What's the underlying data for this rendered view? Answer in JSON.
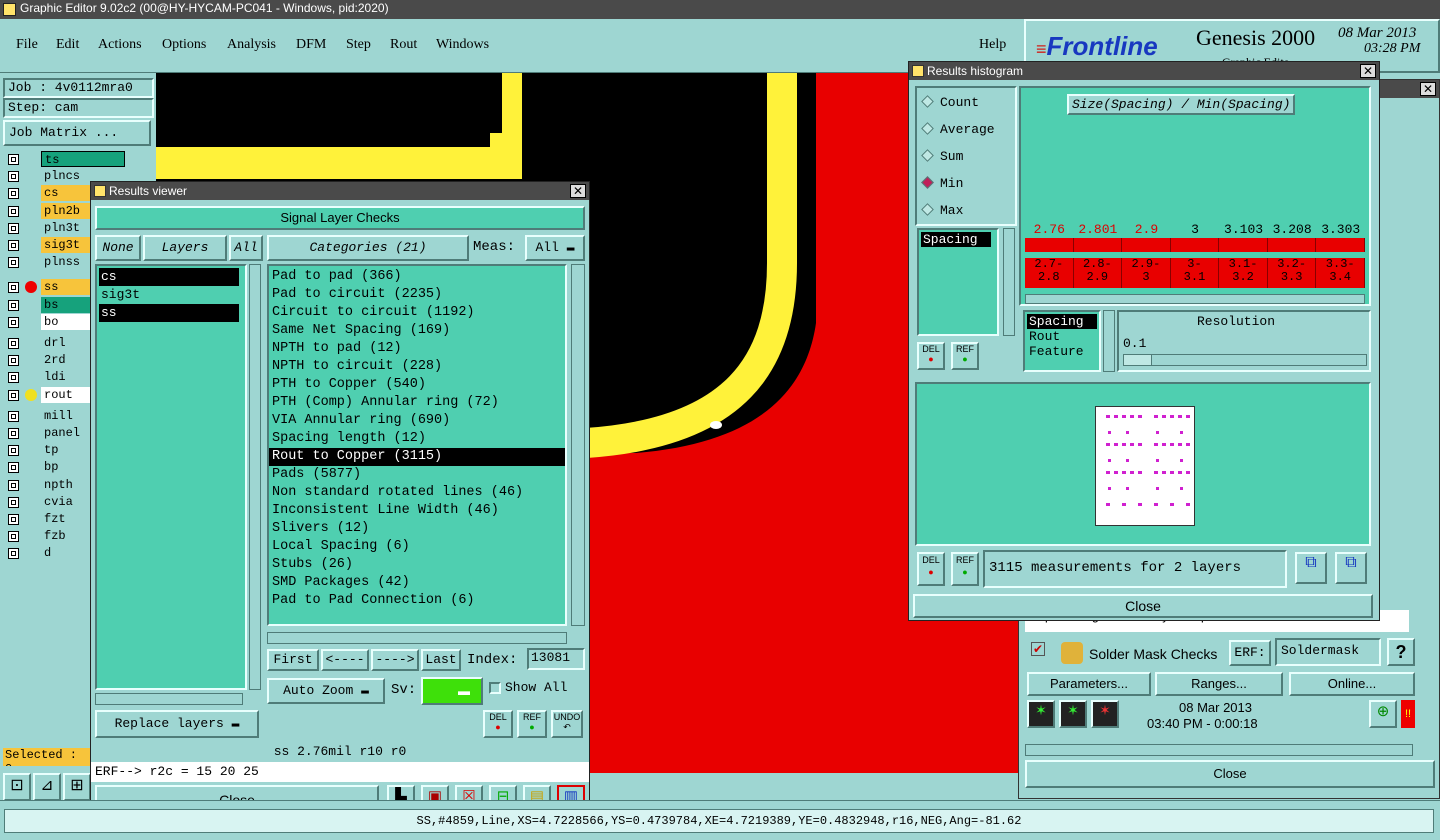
{
  "app": {
    "title": "Graphic Editor 9.02c2 (00@HY-HYCAM-PC041 - Windows, pid:2020)",
    "menu": [
      "File",
      "Edit",
      "Actions",
      "Options",
      "Analysis",
      "DFM",
      "Step",
      "Rout",
      "Windows"
    ],
    "help": "Help",
    "brand": "Frontline",
    "product": "Genesis 2000",
    "date": "08 Mar 2013",
    "time": "03:28 PM",
    "subtitle_partial": "Graphic Edito"
  },
  "left_panel": {
    "job": "Job : 4v0112mra0",
    "step": "Step: cam",
    "job_matrix": "Job Matrix ...",
    "layers": [
      {
        "name": "ts",
        "color": "#16a27c"
      },
      {
        "name": "plncs",
        "color": "#9ed6d2"
      },
      {
        "name": "cs",
        "color": "#f7c43b"
      },
      {
        "name": "pln2b",
        "color": "#f7c43b"
      },
      {
        "name": "pln3t",
        "color": "#9ed6d2"
      },
      {
        "name": "sig3t",
        "color": "#f7c43b"
      },
      {
        "name": "plnss",
        "color": "#9ed6d2"
      },
      {
        "name": "ss",
        "color": "#f7c43b"
      },
      {
        "name": "bs",
        "color": "#16a27c"
      },
      {
        "name": "bo",
        "color": "#ffffff"
      },
      {
        "name": "drl",
        "color": "#9ed6d2"
      },
      {
        "name": "2rd",
        "color": "#9ed6d2"
      },
      {
        "name": "ldi",
        "color": "#9ed6d2"
      },
      {
        "name": "rout",
        "color": "#ffffff"
      },
      {
        "name": "mill",
        "color": "#9ed6d2"
      },
      {
        "name": "panel",
        "color": "#9ed6d2"
      },
      {
        "name": "tp",
        "color": "#9ed6d2"
      },
      {
        "name": "bp",
        "color": "#9ed6d2"
      },
      {
        "name": "npth",
        "color": "#9ed6d2"
      },
      {
        "name": "cvia",
        "color": "#9ed6d2"
      },
      {
        "name": "fzt",
        "color": "#9ed6d2"
      },
      {
        "name": "fzb",
        "color": "#9ed6d2"
      },
      {
        "name": "d",
        "color": "#9ed6d2"
      }
    ],
    "selected": "Selected : 0"
  },
  "results_viewer": {
    "title": "Results viewer",
    "header": "Signal Layer Checks",
    "none_btn": "None",
    "layers_btn": "Layers",
    "all_btn": "All",
    "categories_btn": "Categories (21)",
    "meas_label": "Meas:",
    "meas_value": "All",
    "layer_list": [
      "cs",
      "sig3t",
      "ss"
    ],
    "categories": [
      "Pad to pad (366)",
      "Pad to circuit (2235)",
      "Circuit to circuit (1192)",
      "Same Net Spacing (169)",
      "NPTH to pad (12)",
      "NPTH to circuit (228)",
      "PTH to Copper (540)",
      "PTH (Comp) Annular ring (72)",
      "VIA Annular ring (690)",
      "Spacing length (12)",
      "Rout to Copper (3115)",
      "Pads (5877)",
      "Non standard rotated lines (46)",
      "Inconsistent Line Width (46)",
      "Slivers (12)",
      "Local Spacing (6)",
      "Stubs (26)",
      "SMD Packages (42)",
      "Pad to Pad Connection (6)"
    ],
    "selected_category": "Rout to Copper (3115)",
    "first": "First",
    "prev": "<----",
    "next": "---->",
    "last": "Last",
    "index_label": "Index:",
    "index_value": "13081",
    "auto_zoom": "Auto Zoom",
    "sv_label": "Sv:",
    "show_all": "Show All",
    "replace_layers": "Replace layers",
    "del": "DEL",
    "ref": "REF",
    "undo": "UNDO",
    "status": "ss 2.76mil  r10  r0",
    "erf": "ERF--> r2c = 15 20 25",
    "close": "Close"
  },
  "histogram": {
    "title": "Results histogram",
    "modes": [
      "Count",
      "Average",
      "Sum",
      "Min",
      "Max"
    ],
    "selected_mode": "Min",
    "chart_title": "Size(Spacing) / Min(Spacing)",
    "bars": [
      {
        "value": "2.76",
        "range": "2.7-\n2.8",
        "red": true
      },
      {
        "value": "2.801",
        "range": "2.8-\n2.9",
        "red": true
      },
      {
        "value": "2.9",
        "range": "2.9-\n3",
        "red": true
      },
      {
        "value": "3",
        "range": "3-\n3.1",
        "red": false
      },
      {
        "value": "3.103",
        "range": "3.1-\n3.2",
        "red": false
      },
      {
        "value": "3.208",
        "range": "3.2-\n3.3",
        "red": false
      },
      {
        "value": "3.303",
        "range": "3.3-\n3.4",
        "red": false
      }
    ],
    "type_list": [
      "Spacing"
    ],
    "measure_list": [
      "Spacing",
      "Rout",
      "Feature"
    ],
    "resolution_label": "Resolution",
    "resolution_value": "0.1",
    "measurements": "3115 measurements for 2 layers",
    "close": "Close",
    "del": "DEL",
    "ref": "REF"
  },
  "right_panel": {
    "power_ground_text": "1 power/ground layers processed",
    "solder_mask": "Solder Mask Checks",
    "erf_label": "ERF:",
    "erf_value": "Soldermask",
    "parameters": "Parameters...",
    "ranges": "Ranges...",
    "online": "Online...",
    "date": "08 Mar 2013",
    "time": "03:40 PM - 0:00:18",
    "close": "Close",
    "help_q": "?"
  },
  "statusbar": {
    "text": "SS,#4859,Line,XS=4.7228566,YS=0.4739784,XE=4.7219389,YE=0.4832948,r16,NEG,Ang=-81.62"
  }
}
